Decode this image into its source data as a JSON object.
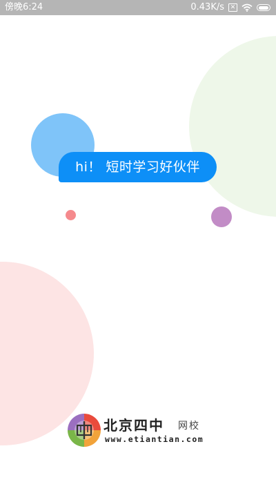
{
  "status_bar": {
    "time": "傍晚6:24",
    "network_speed": "0.43K/s",
    "icons": [
      "sim-x-icon",
      "wifi-icon",
      "battery-icon"
    ]
  },
  "splash": {
    "greeting": "hi！ 短时学习好伙伴"
  },
  "logo": {
    "title": "北京四中",
    "subtitle": "网校",
    "url": "www.etiantian.com"
  },
  "colors": {
    "bubble": "#0d8ff7",
    "circle_blue": "#7fc4f9",
    "circle_green": "#eef7e9",
    "circle_pink": "#fde4e4",
    "dot_red": "#f58a8d",
    "dot_purple": "#c28cc6",
    "status_bar": "#b5b5b5"
  }
}
